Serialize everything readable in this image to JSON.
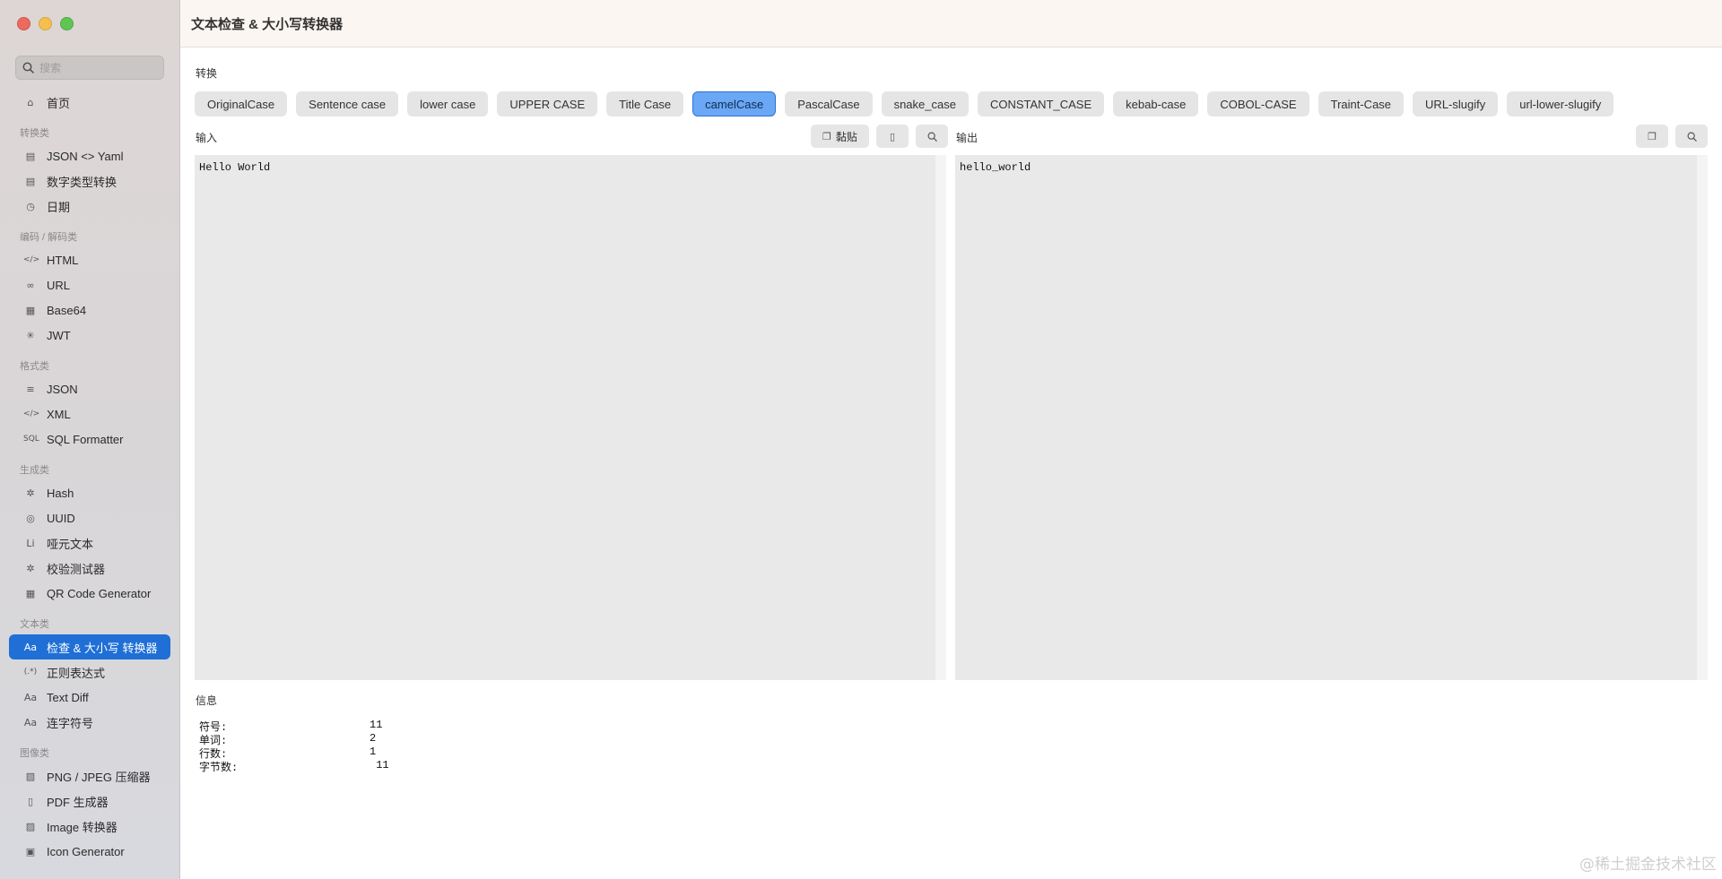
{
  "sidebar": {
    "search_placeholder": "搜索",
    "home": {
      "label": "首页",
      "icon": "⌂"
    },
    "sections": [
      {
        "title": "转换类",
        "items": [
          {
            "label": "JSON <> Yaml",
            "icon": "▤"
          },
          {
            "label": "数字类型转换",
            "icon": "▤"
          },
          {
            "label": "日期",
            "icon": "◷"
          }
        ]
      },
      {
        "title": "编码 / 解码类",
        "items": [
          {
            "label": "HTML",
            "icon": "</>"
          },
          {
            "label": "URL",
            "icon": "∞"
          },
          {
            "label": "Base64",
            "icon": "▦"
          },
          {
            "label": "JWT",
            "icon": "✳"
          }
        ]
      },
      {
        "title": "格式类",
        "items": [
          {
            "label": "JSON",
            "icon": "≡"
          },
          {
            "label": "XML",
            "icon": "</>"
          },
          {
            "label": "SQL Formatter",
            "icon": "SQL"
          }
        ]
      },
      {
        "title": "生成类",
        "items": [
          {
            "label": "Hash",
            "icon": "✲"
          },
          {
            "label": "UUID",
            "icon": "◎"
          },
          {
            "label": "哑元文本",
            "icon": "Li"
          },
          {
            "label": "校验测试器",
            "icon": "✲"
          },
          {
            "label": "QR Code Generator",
            "icon": "▦"
          }
        ]
      },
      {
        "title": "文本类",
        "items": [
          {
            "label": "检查 & 大小写 转换器",
            "icon": "Aa",
            "active": true
          },
          {
            "label": "正则表达式",
            "icon": "(.*)"
          },
          {
            "label": "Text Diff",
            "icon": "Aa"
          },
          {
            "label": "连字符号",
            "icon": "Aa"
          }
        ]
      },
      {
        "title": "图像类",
        "items": [
          {
            "label": "PNG / JPEG 压缩器",
            "icon": "▨"
          },
          {
            "label": "PDF 生成器",
            "icon": "▯"
          },
          {
            "label": "Image 转换器",
            "icon": "▨"
          },
          {
            "label": "Icon Generator",
            "icon": "▣"
          }
        ]
      }
    ]
  },
  "header": {
    "title": "文本检查 & 大小写转换器"
  },
  "convert": {
    "label": "转换",
    "options": [
      "OriginalCase",
      "Sentence case",
      "lower case",
      "UPPER CASE",
      "Title Case",
      "camelCase",
      "PascalCase",
      "snake_case",
      "CONSTANT_CASE",
      "kebab-case",
      "COBOL-CASE",
      "Traint-Case",
      "URL-slugify",
      "url-lower-slugify"
    ],
    "selected": "camelCase"
  },
  "input": {
    "label": "输入",
    "paste_label": "黏贴",
    "text": "Hello World"
  },
  "output": {
    "label": "输出",
    "text": "hello_world"
  },
  "info": {
    "label": "信息",
    "rows": [
      {
        "key": "符号:",
        "value": "11"
      },
      {
        "key": "单词:",
        "value": "2"
      },
      {
        "key": "行数:",
        "value": "1"
      },
      {
        "key": "字节数:",
        "value": " 11"
      }
    ]
  },
  "watermark": "@稀土掘金技术社区",
  "colors": {
    "accent": "#1f6fd6",
    "selected_button": "#6aa8f5",
    "editor_bg": "#e9e9e9"
  }
}
